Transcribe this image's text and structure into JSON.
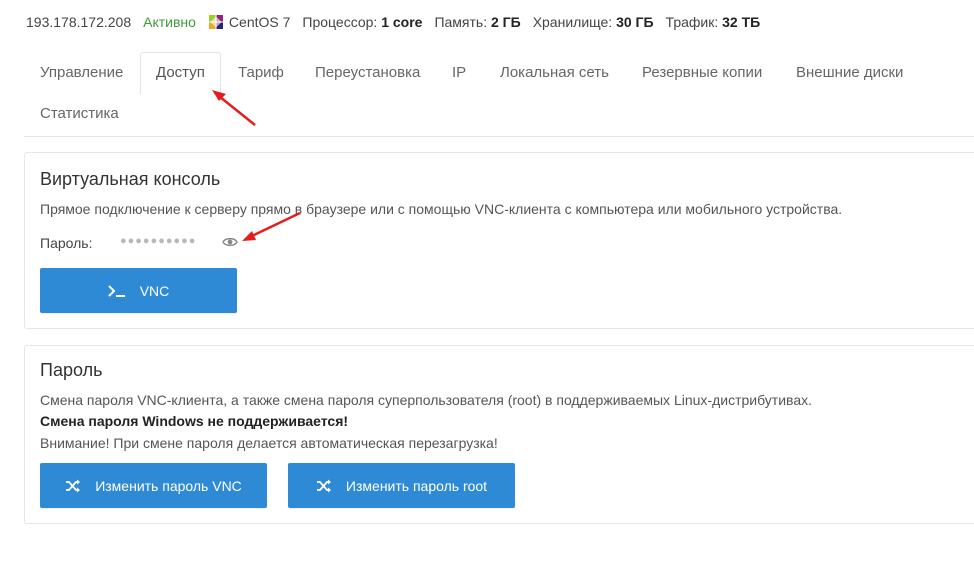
{
  "server": {
    "ip": "193.178.172.208",
    "status": "Активно",
    "os": "CentOS 7",
    "cpu_label": "Процессор:",
    "cpu_value": "1 core",
    "mem_label": "Память:",
    "mem_value": "2 ГБ",
    "storage_label": "Хранилище:",
    "storage_value": "30 ГБ",
    "traffic_label": "Трафик:",
    "traffic_value": "32 ТБ"
  },
  "tabs": [
    {
      "label": "Управление"
    },
    {
      "label": "Доступ",
      "active": true
    },
    {
      "label": "Тариф"
    },
    {
      "label": "Переустановка"
    },
    {
      "label": "IP"
    },
    {
      "label": "Локальная сеть"
    },
    {
      "label": "Резервные копии"
    },
    {
      "label": "Внешние диски"
    },
    {
      "label": "Статистика"
    }
  ],
  "console": {
    "title": "Виртуальная консоль",
    "description": "Прямое подключение к серверу прямо в браузере или с помощью VNC-клиента с компьютера или мобильного устройства.",
    "password_label": "Пароль:",
    "password_mask": "●●●●●●●●●●",
    "vnc_button": "VNC"
  },
  "password": {
    "title": "Пароль",
    "line1": "Смена пароля VNC-клиента, а также смена пароля суперпользователя (root) в поддерживаемых Linux-дистрибутивах.",
    "line2": "Смена пароля Windows не поддерживается!",
    "line3": "Внимание! При смене пароля делается автоматическая перезагрузка!",
    "btn_vnc": "Изменить пароль VNC",
    "btn_root": "Изменить пароль root"
  },
  "colors": {
    "accent": "#2f8ad6",
    "status": "#3c9a3a",
    "annotation": "#e41e1e"
  }
}
